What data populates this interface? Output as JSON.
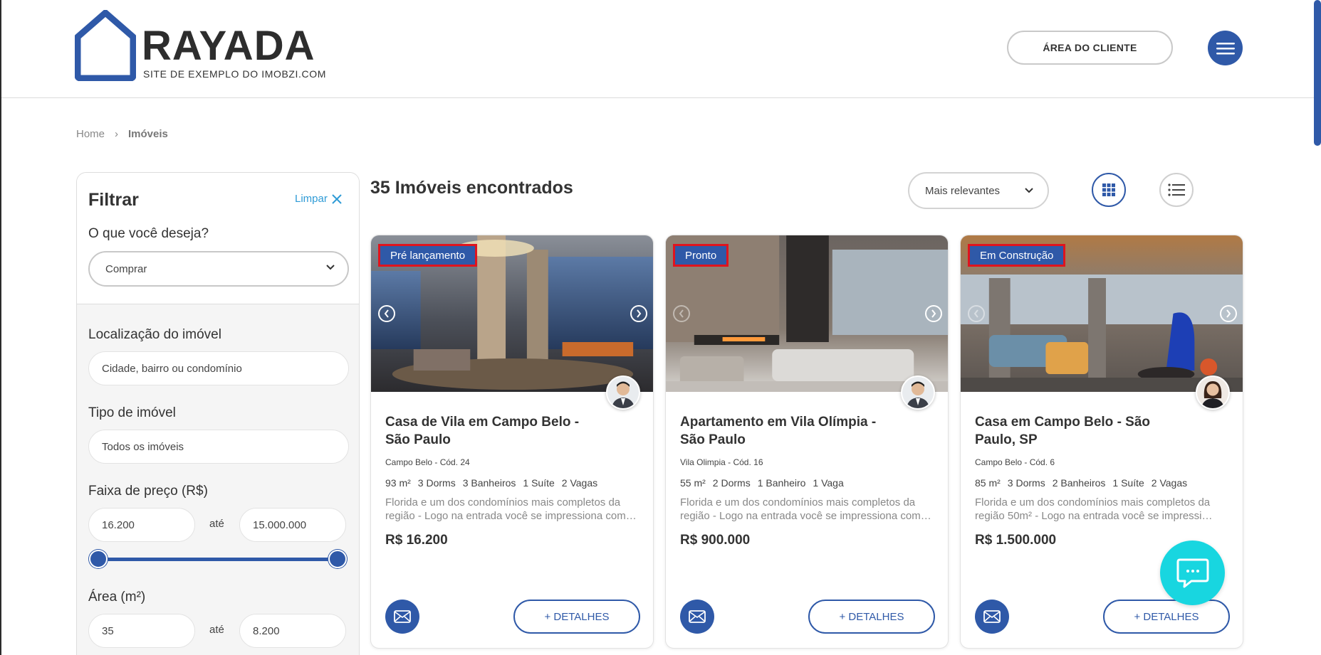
{
  "brand": {
    "name": "RAYADA",
    "tagline": "SITE DE EXEMPLO DO IMOBZI.COM",
    "color": "#2f59a8"
  },
  "header": {
    "client_area_label": "ÁREA DO CLIENTE",
    "menu_icon": "hamburger-icon"
  },
  "breadcrumb": {
    "home": "Home",
    "separator": "›",
    "current": "Imóveis"
  },
  "filter": {
    "title": "Filtrar",
    "clear_label": "Limpar",
    "intent_label": "O que você deseja?",
    "intent_value": "Comprar",
    "location_label": "Localização do imóvel",
    "location_placeholder": "Cidade, bairro ou condomínio",
    "type_label": "Tipo de imóvel",
    "type_value": "Todos os imóveis",
    "price_label": "Faixa de preço (R$)",
    "price_min": "16.200",
    "price_max": "15.000.000",
    "range_sep": "até",
    "area_label": "Área (m²)",
    "area_min": "35",
    "area_max": "8.200"
  },
  "results": {
    "title": "35 Imóveis encontrados",
    "sort_value": "Mais relevantes"
  },
  "cards": [
    {
      "badge": "Pré lançamento",
      "title": "Casa de Vila em Campo Belo - São Paulo",
      "location": "Campo Belo - Cód. 24",
      "area": "93 m²",
      "features": [
        "3 Dorms",
        "3 Banheiros",
        "1 Suíte",
        "2 Vagas"
      ],
      "description": "Florida e um dos condomínios mais completos da região - Logo na entrada você se impressiona com…",
      "price": "R$ 16.200",
      "details_label": "+ DETALHES"
    },
    {
      "badge": "Pronto",
      "title": "Apartamento em Vila Olímpia - São Paulo",
      "location": "Vila Olimpia - Cód. 16",
      "area": "55 m²",
      "features": [
        "2 Dorms",
        "1 Banheiro",
        "1 Vaga"
      ],
      "description": "Florida e um dos condomínios mais completos da região - Logo na entrada você se impressiona com…",
      "price": "R$ 900.000",
      "details_label": "+ DETALHES"
    },
    {
      "badge": "Em Construção",
      "title": "Casa em Campo Belo - São Paulo, SP",
      "location": "Campo Belo - Cód. 6",
      "area": "85 m²",
      "features": [
        "3 Dorms",
        "2 Banheiros",
        "1 Suíte",
        "2 Vagas"
      ],
      "description": "Florida e um dos condomínios mais completos da região 50m² - Logo na entrada você se impressi…",
      "price": "R$ 1.500.000",
      "details_label": "+ DETALHES"
    }
  ],
  "chat_icon": "chat-bubble-icon"
}
